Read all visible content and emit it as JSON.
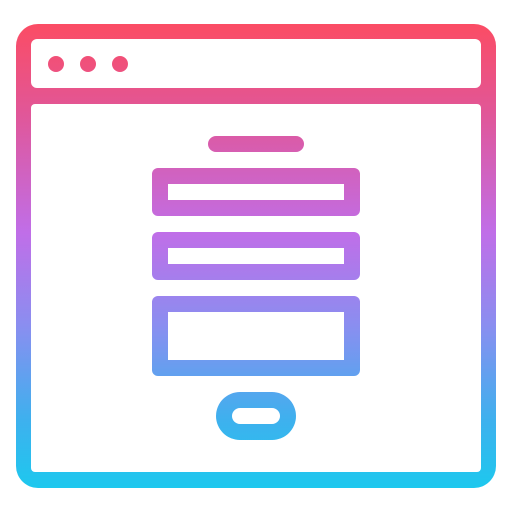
{
  "icon": {
    "name": "browser-contact-form-icon",
    "style": "outline",
    "gradient": {
      "direction": "top-to-bottom",
      "stops": [
        "#fb4c64",
        "#e0579a",
        "#c06ee8",
        "#8a8ef0",
        "#3fb0ee",
        "#1dc8ee"
      ]
    },
    "background": "#ffffff",
    "window": {
      "control_dots": 3
    },
    "form": {
      "heading_bar": true,
      "fields": [
        "text-field",
        "text-field",
        "textarea"
      ],
      "submit_button": true
    }
  }
}
